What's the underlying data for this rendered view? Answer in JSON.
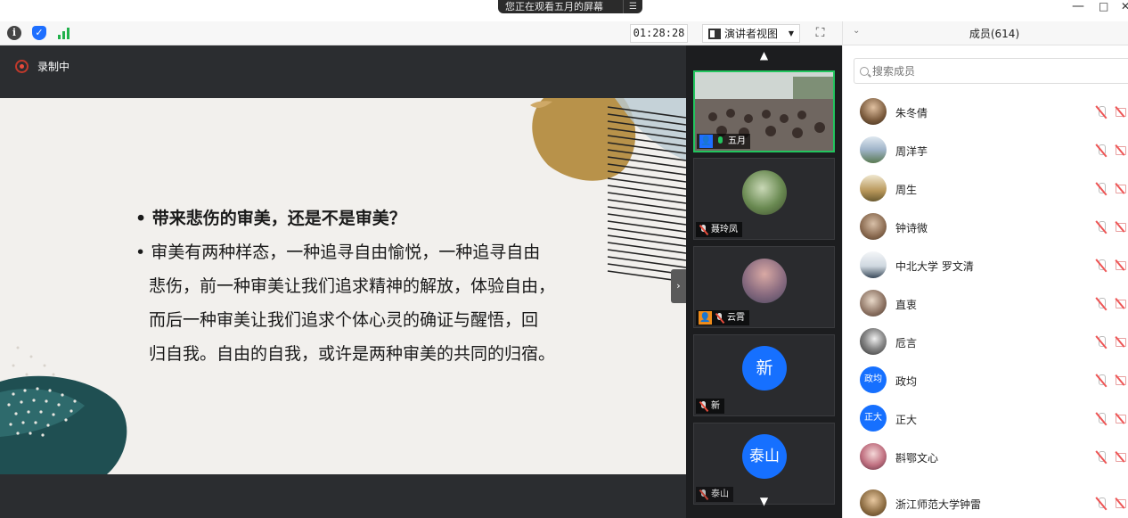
{
  "banner": {
    "sharing_text": "您正在观看五月的屏幕",
    "menu_icon": "list-icon"
  },
  "window_controls": {
    "minimize": "—",
    "maximize": "□",
    "close": "✕"
  },
  "toolbar": {
    "info_icon": "info-icon",
    "security_icon": "shield-icon",
    "network_icon": "signal-icon",
    "timer": "01:28:28",
    "view_label": "演讲者视图",
    "fullscreen_icon": "fullscreen-icon"
  },
  "recording": {
    "label": "录制中",
    "color": "#e74c3c"
  },
  "slide": {
    "bullets": [
      {
        "text": "• 带来悲伤的审美，还是不是审美？",
        "bold": true
      },
      {
        "text": "• 审美有两种样态，一种追寻自由愉悦，一种追寻自由",
        "bold": false
      },
      {
        "text": "悲伤，前一种审美让我们追求精神的解放，体验自由，",
        "bold": false
      },
      {
        "text": "而后一种审美让我们追求个体心灵的确证与醒悟，回",
        "bold": false
      },
      {
        "text": "归自我。自由的自我，或许是两种审美的共同的归宿。",
        "bold": false
      }
    ]
  },
  "gallery": {
    "tiles": [
      {
        "name": "五月",
        "active": true,
        "host": true
      },
      {
        "name": "聂玲凤",
        "active": false
      },
      {
        "name": "云霄",
        "active": false,
        "host_orange": true
      },
      {
        "name": "新",
        "avatar_text": "新",
        "active": false
      },
      {
        "name": "泰山",
        "avatar_text": "泰山",
        "active": false
      }
    ]
  },
  "members": {
    "title": "成员(614)",
    "search_placeholder": "搜索成员",
    "list": [
      {
        "name": "朱冬倩",
        "avatar_color": "#7a5a3c"
      },
      {
        "name": "周洋芋",
        "avatar_color": "#6a8fb0"
      },
      {
        "name": "周生",
        "avatar_color": "#b8975a"
      },
      {
        "name": "钟诗微",
        "avatar_color": "#8a6a50"
      },
      {
        "name": "中北大学 罗文清",
        "avatar_color": "#9fb3c8"
      },
      {
        "name": "直衷",
        "avatar_color": "#8a7060"
      },
      {
        "name": "卮言",
        "avatar_color": "#3a3a3a"
      },
      {
        "name": "政均",
        "avatar_text": "政均"
      },
      {
        "name": "正大",
        "avatar_text": "正大"
      },
      {
        "name": "斟鄂文心",
        "avatar_color": "#c07080"
      },
      {
        "name": "浙江师范大学钟雷",
        "avatar_color": "#8a6a40"
      }
    ]
  }
}
